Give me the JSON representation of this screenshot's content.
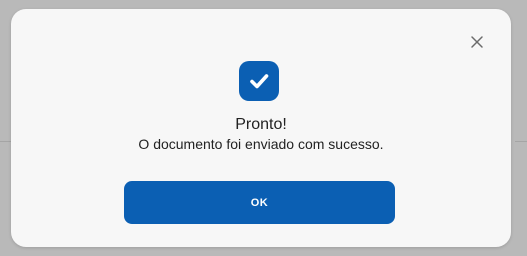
{
  "dialog": {
    "title": "Pronto!",
    "message": "O documento foi enviado com sucesso.",
    "confirm_label": "OK",
    "close_icon": "close-icon",
    "status_icon": "check-icon"
  },
  "colors": {
    "accent": "#0b5fb3",
    "dialog_background": "#f7f7f7",
    "backdrop": "#b9b9b9",
    "text": "#222222"
  }
}
